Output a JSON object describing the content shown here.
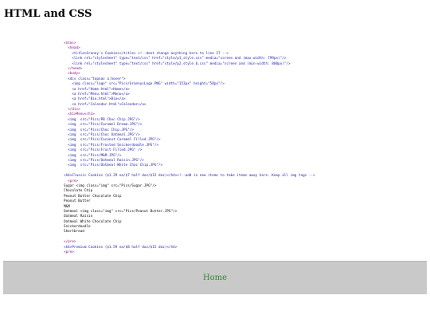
{
  "header": {
    "title": "HTML and CSS"
  },
  "code_lines": [
    "<html>",
    "  <head>",
    "    <title>Granny's Cookies</title> <!--dont change anything here to line 27 -->",
    "    <link rel=\"stylesheet\" type=\"text/css\" href=\"style/p1_style.css\" media=\"screen and (max-width: 799px)\"/>",
    "    <link rel=\"stylesheet\" type=\"text/css\" href=\"style/p2_style_b.css\" media=\"screen and (min-width: 800px)\"/>",
    "  </head>",
    "  <body>",
    "  <div class=\"topnav a:hover\">",
    "    <img class=\"logo\" src=\"Pics/GrannysLogo.PNG\" width=\"153px\" height=\"58px\"/>",
    "    <a href=\"Home.html\">Home</a>",
    "    <a href=\"Menu.html\">Menu</a>",
    "    <a href=\"Bio.html\">Bio</a>",
    "    <a href=\"Calendar.html\">Calendar</a>",
    "  </div>",
    "  <h1>Menu</h1>",
    "  <img  src=\"Pics/PB Choc Chip.JPG\"/>",
    "  <img  src=\"Pics/Caramel Dream.JPG\"/>",
    "  <img  src=\"Pics/Choc Chip.JPG\"/>",
    "  <img  src=\"Pics/Choc Oatmeal.JPG\"/>",
    "  <img  src=\"Pics/Coconut Caramel Filled.JPG\"/>",
    "  <img  src=\"Pics/Frosted Snickerdoodle.JPG\"/>",
    "  <img  src=\"Pics/Fruit Filled.JPG\" />",
    "  <img  src=\"Pics/M&M.JPG\"/>",
    "  <img  src=\"Pics/Oatmeal Raisin.JPG\"/>",
    "  <img  src=\"Pics/Oatmeal White Choc Chip.JPG\"/>",
    "",
    "<h4>Classic Cookies ($1.29 ea/$7 half doz/$12 doz)</h4><!--add in new items to take items away here. Keep all img tags -->",
    "  <pre>",
    "Sugar <img class=\"img\" src=\"Pics/Sugar.JPG\"/>",
    "Chocolate Chip",
    "Peanut Butter Chocolate Chip",
    "Peanut Butter",
    "M&M",
    "Oatmeal <img class=\"img\" src=\"Pics/Peanut Butter.JPG\"/>",
    "Oatmeal Raisin",
    "Oatmeal White Chocolate Chip",
    "Snickerdoodle",
    "Shortbread",
    "",
    "</pre>",
    "<h4>Premium Cookies ($1.59 ea/$8 half doz/$15 doz)</h4>",
    "<pre>"
  ],
  "line_colors": [
    "p",
    "p",
    "b",
    "b",
    "b",
    "p",
    "p",
    "b",
    "b",
    "b",
    "b",
    "b",
    "b",
    "p",
    "p",
    "b",
    "b",
    "b",
    "b",
    "b",
    "b",
    "b",
    "b",
    "b",
    "b",
    "k",
    "b",
    "p",
    "k",
    "k",
    "k",
    "k",
    "k",
    "k",
    "k",
    "k",
    "k",
    "k",
    "k",
    "p",
    "b",
    "p"
  ],
  "footer": {
    "home_label": "Home"
  }
}
